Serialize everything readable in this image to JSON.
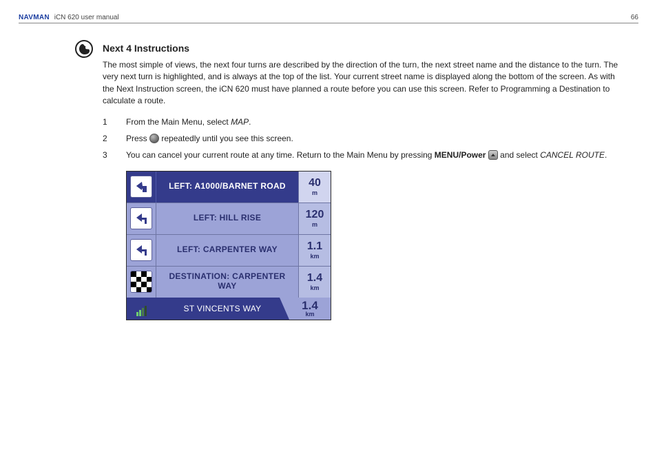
{
  "header": {
    "brand": "NAVMAN",
    "manual_title": "iCN 620 user manual",
    "page_number": "66"
  },
  "section": {
    "heading": "Next 4 Instructions",
    "intro": "The most simple of views, the next four turns are described by the direction of the turn, the next street name and the distance to the turn. The very next turn is highlighted, and is always at the top of the list. Your current street name is displayed along the bottom of the screen. As with the Next Instruction screen, the iCN 620 must have planned a route before you can use this screen. Refer to Programming a Destination to calculate a route."
  },
  "steps": {
    "s1_a": "From the Main Menu, select ",
    "s1_b": "MAP",
    "s1_c": ".",
    "s2_a": "Press ",
    "s2_b": " repeatedly until you see this screen.",
    "s3_a": "You can cancel your current route at any time. Return to the Main Menu by pressing ",
    "s3_b": "MENU/Power",
    "s3_c": " and select ",
    "s3_d": "CANCEL ROUTE",
    "s3_e": "."
  },
  "device": {
    "rows": [
      {
        "text": "LEFT: A1000/BARNET ROAD",
        "dist": "40",
        "unit": "m",
        "icon": "turn-left",
        "highlight": true
      },
      {
        "text": "LEFT: HILL RISE",
        "dist": "120",
        "unit": "m",
        "icon": "turn-left",
        "highlight": false
      },
      {
        "text": "LEFT: CARPENTER WAY",
        "dist": "1.1",
        "unit": "km",
        "icon": "turn-left",
        "highlight": false
      },
      {
        "text": "DESTINATION: CARPENTER WAY",
        "dist": "1.4",
        "unit": "km",
        "icon": "destination",
        "highlight": false
      }
    ],
    "current_street": "ST VINCENTS WAY",
    "remaining": {
      "dist": "1.4",
      "unit": "km"
    }
  }
}
